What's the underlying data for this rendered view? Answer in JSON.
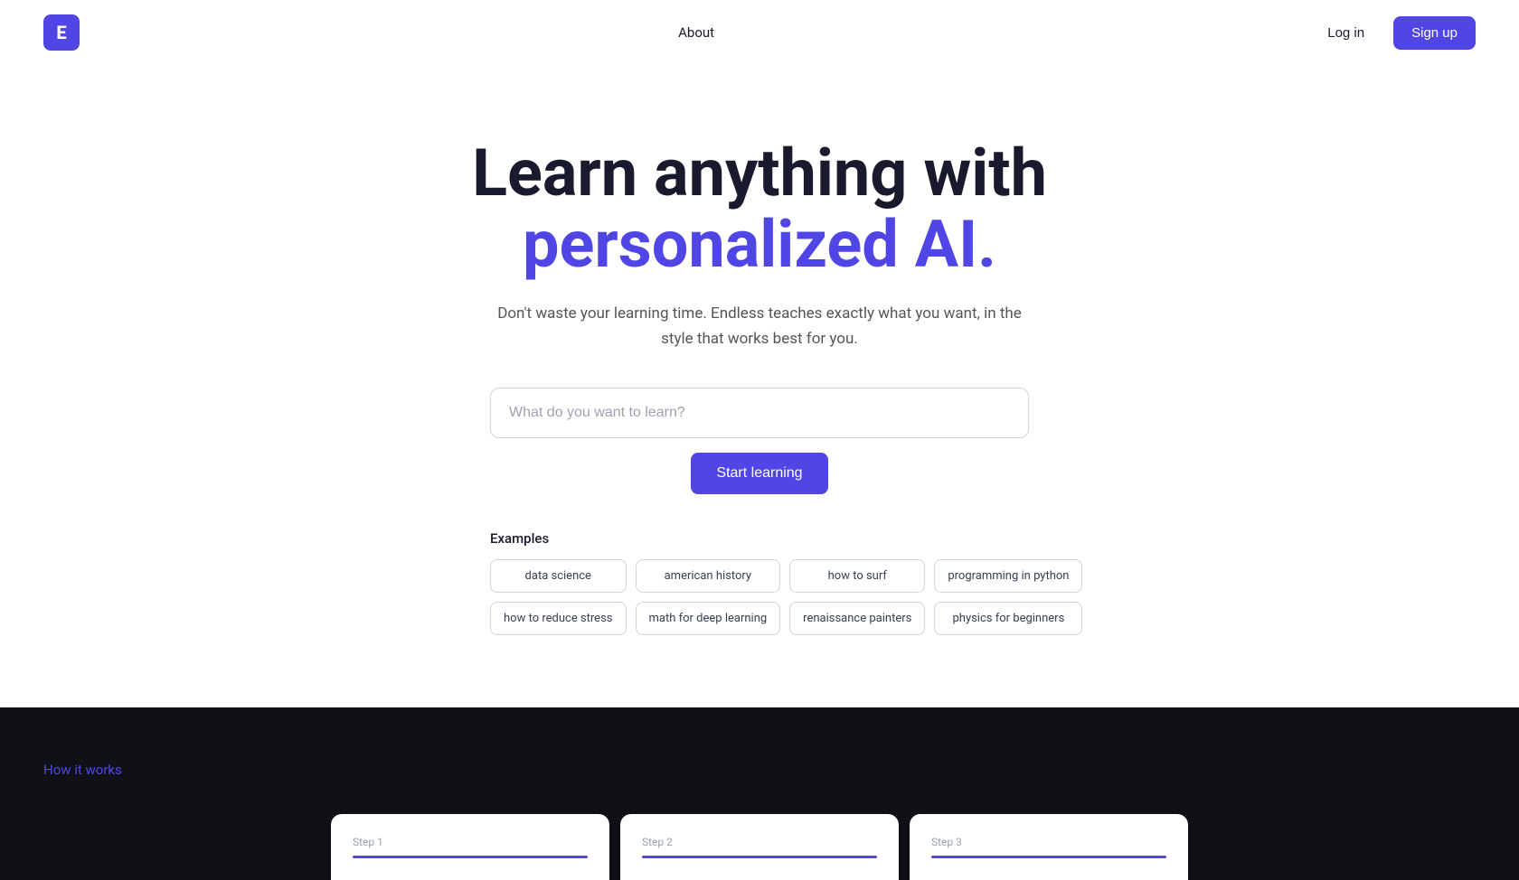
{
  "nav": {
    "logo_text": "E",
    "links": [
      "About"
    ],
    "login_label": "Log in",
    "signup_label": "Sign up"
  },
  "hero": {
    "title_line1": "Learn anything with",
    "title_line2": "personalized AI.",
    "subtitle": "Don't waste your learning time. Endless teaches exactly what you want, in the style that works best for you.",
    "search_placeholder": "What do you want to learn?",
    "start_button_label": "Start learning",
    "examples_label": "Examples",
    "examples_row1": [
      "data science",
      "american history",
      "how to surf",
      "programming in python"
    ],
    "examples_row2": [
      "how to reduce stress",
      "math for deep learning",
      "renaissance painters",
      "physics for beginners"
    ]
  },
  "bottom": {
    "how_it_works_label": "How it works",
    "step1_label": "Step 1",
    "step2_label": "Step 2",
    "step3_label": "Step 3"
  }
}
